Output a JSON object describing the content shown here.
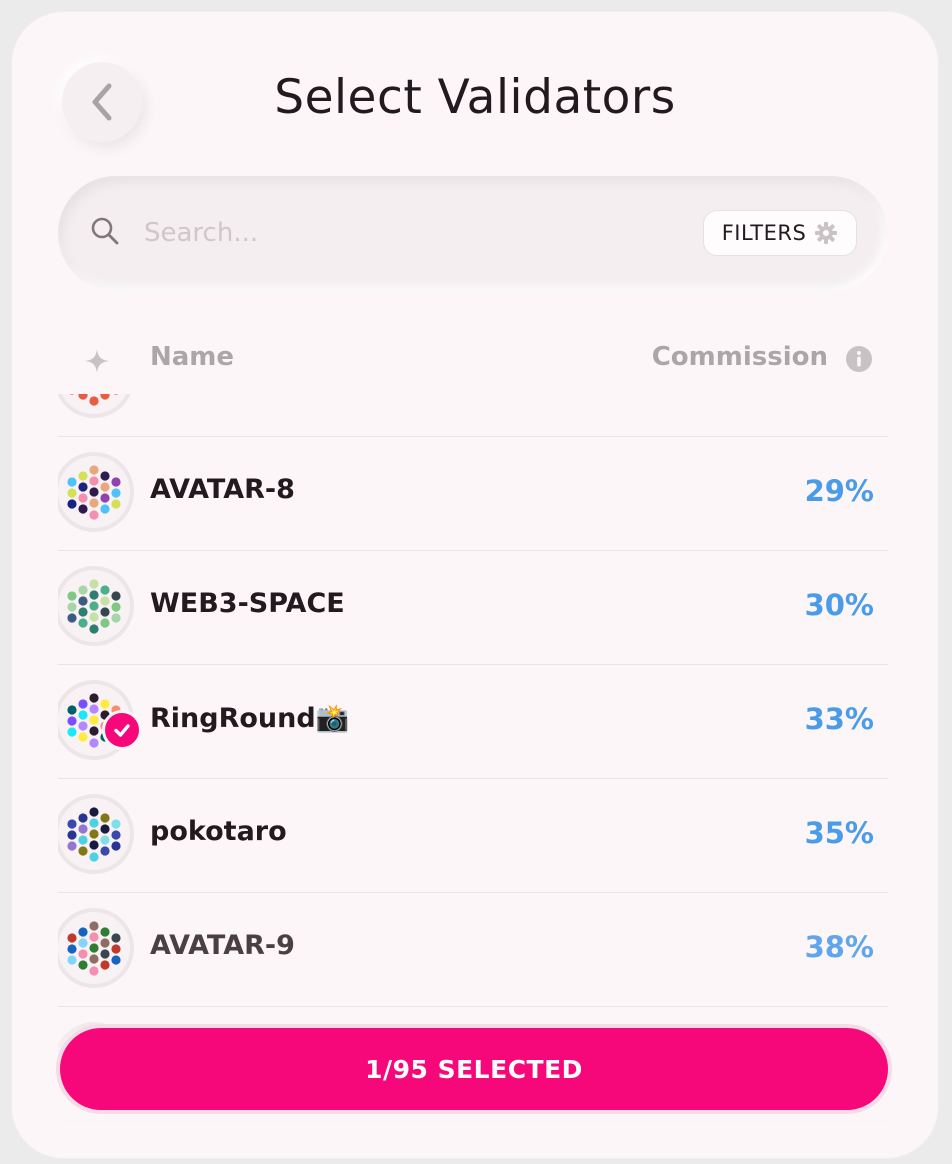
{
  "header": {
    "title": "Select Validators"
  },
  "search": {
    "placeholder": "Search...",
    "value": "",
    "filters_label": "FILTERS"
  },
  "columns": {
    "name": "Name",
    "commission": "Commission"
  },
  "validators": [
    {
      "name": "",
      "commission": "",
      "selected": false,
      "colors": [
        "#e85c40",
        "#f0b030",
        "#c0392b"
      ]
    },
    {
      "name": "AVATAR-8",
      "commission": "29%",
      "selected": false,
      "colors": [
        "#2d1b4e",
        "#e8a87c",
        "#8e44ad",
        "#4fc3f7",
        "#d4e157",
        "#1a237e",
        "#f48fb1"
      ]
    },
    {
      "name": "WEB3-SPACE",
      "commission": "30%",
      "selected": false,
      "colors": [
        "#2e7d6f",
        "#4caf8a",
        "#c5e1a5",
        "#37474f",
        "#81c784",
        "#a5d6a7",
        "#3d5a80"
      ]
    },
    {
      "name": "RingRound📸",
      "commission": "33%",
      "selected": true,
      "colors": [
        "#1de9f6",
        "#b388ff",
        "#ffeb3b",
        "#2d1b2e",
        "#ff8a65",
        "#006064",
        "#7c4dff"
      ]
    },
    {
      "name": "pokotaro",
      "commission": "35%",
      "selected": false,
      "colors": [
        "#283593",
        "#9575cd",
        "#4dd0e1",
        "#827717",
        "#1a1a3e",
        "#80deea",
        "#3949ab"
      ]
    },
    {
      "name": "AVATAR-9",
      "commission": "38%",
      "selected": false,
      "colors": [
        "#c0392b",
        "#1565c0",
        "#81d4fa",
        "#f48fb1",
        "#2e7d32",
        "#8d6e63",
        "#37474f"
      ]
    },
    {
      "name": "",
      "commission": "",
      "selected": false,
      "colors": [
        "#bbbbbb",
        "#dddddd",
        "#999999"
      ]
    }
  ],
  "footer": {
    "selected_label": "1/95 SELECTED"
  },
  "colors": {
    "accent": "#f6077a",
    "commission": "#4b9ce8",
    "text": "#231a20"
  }
}
